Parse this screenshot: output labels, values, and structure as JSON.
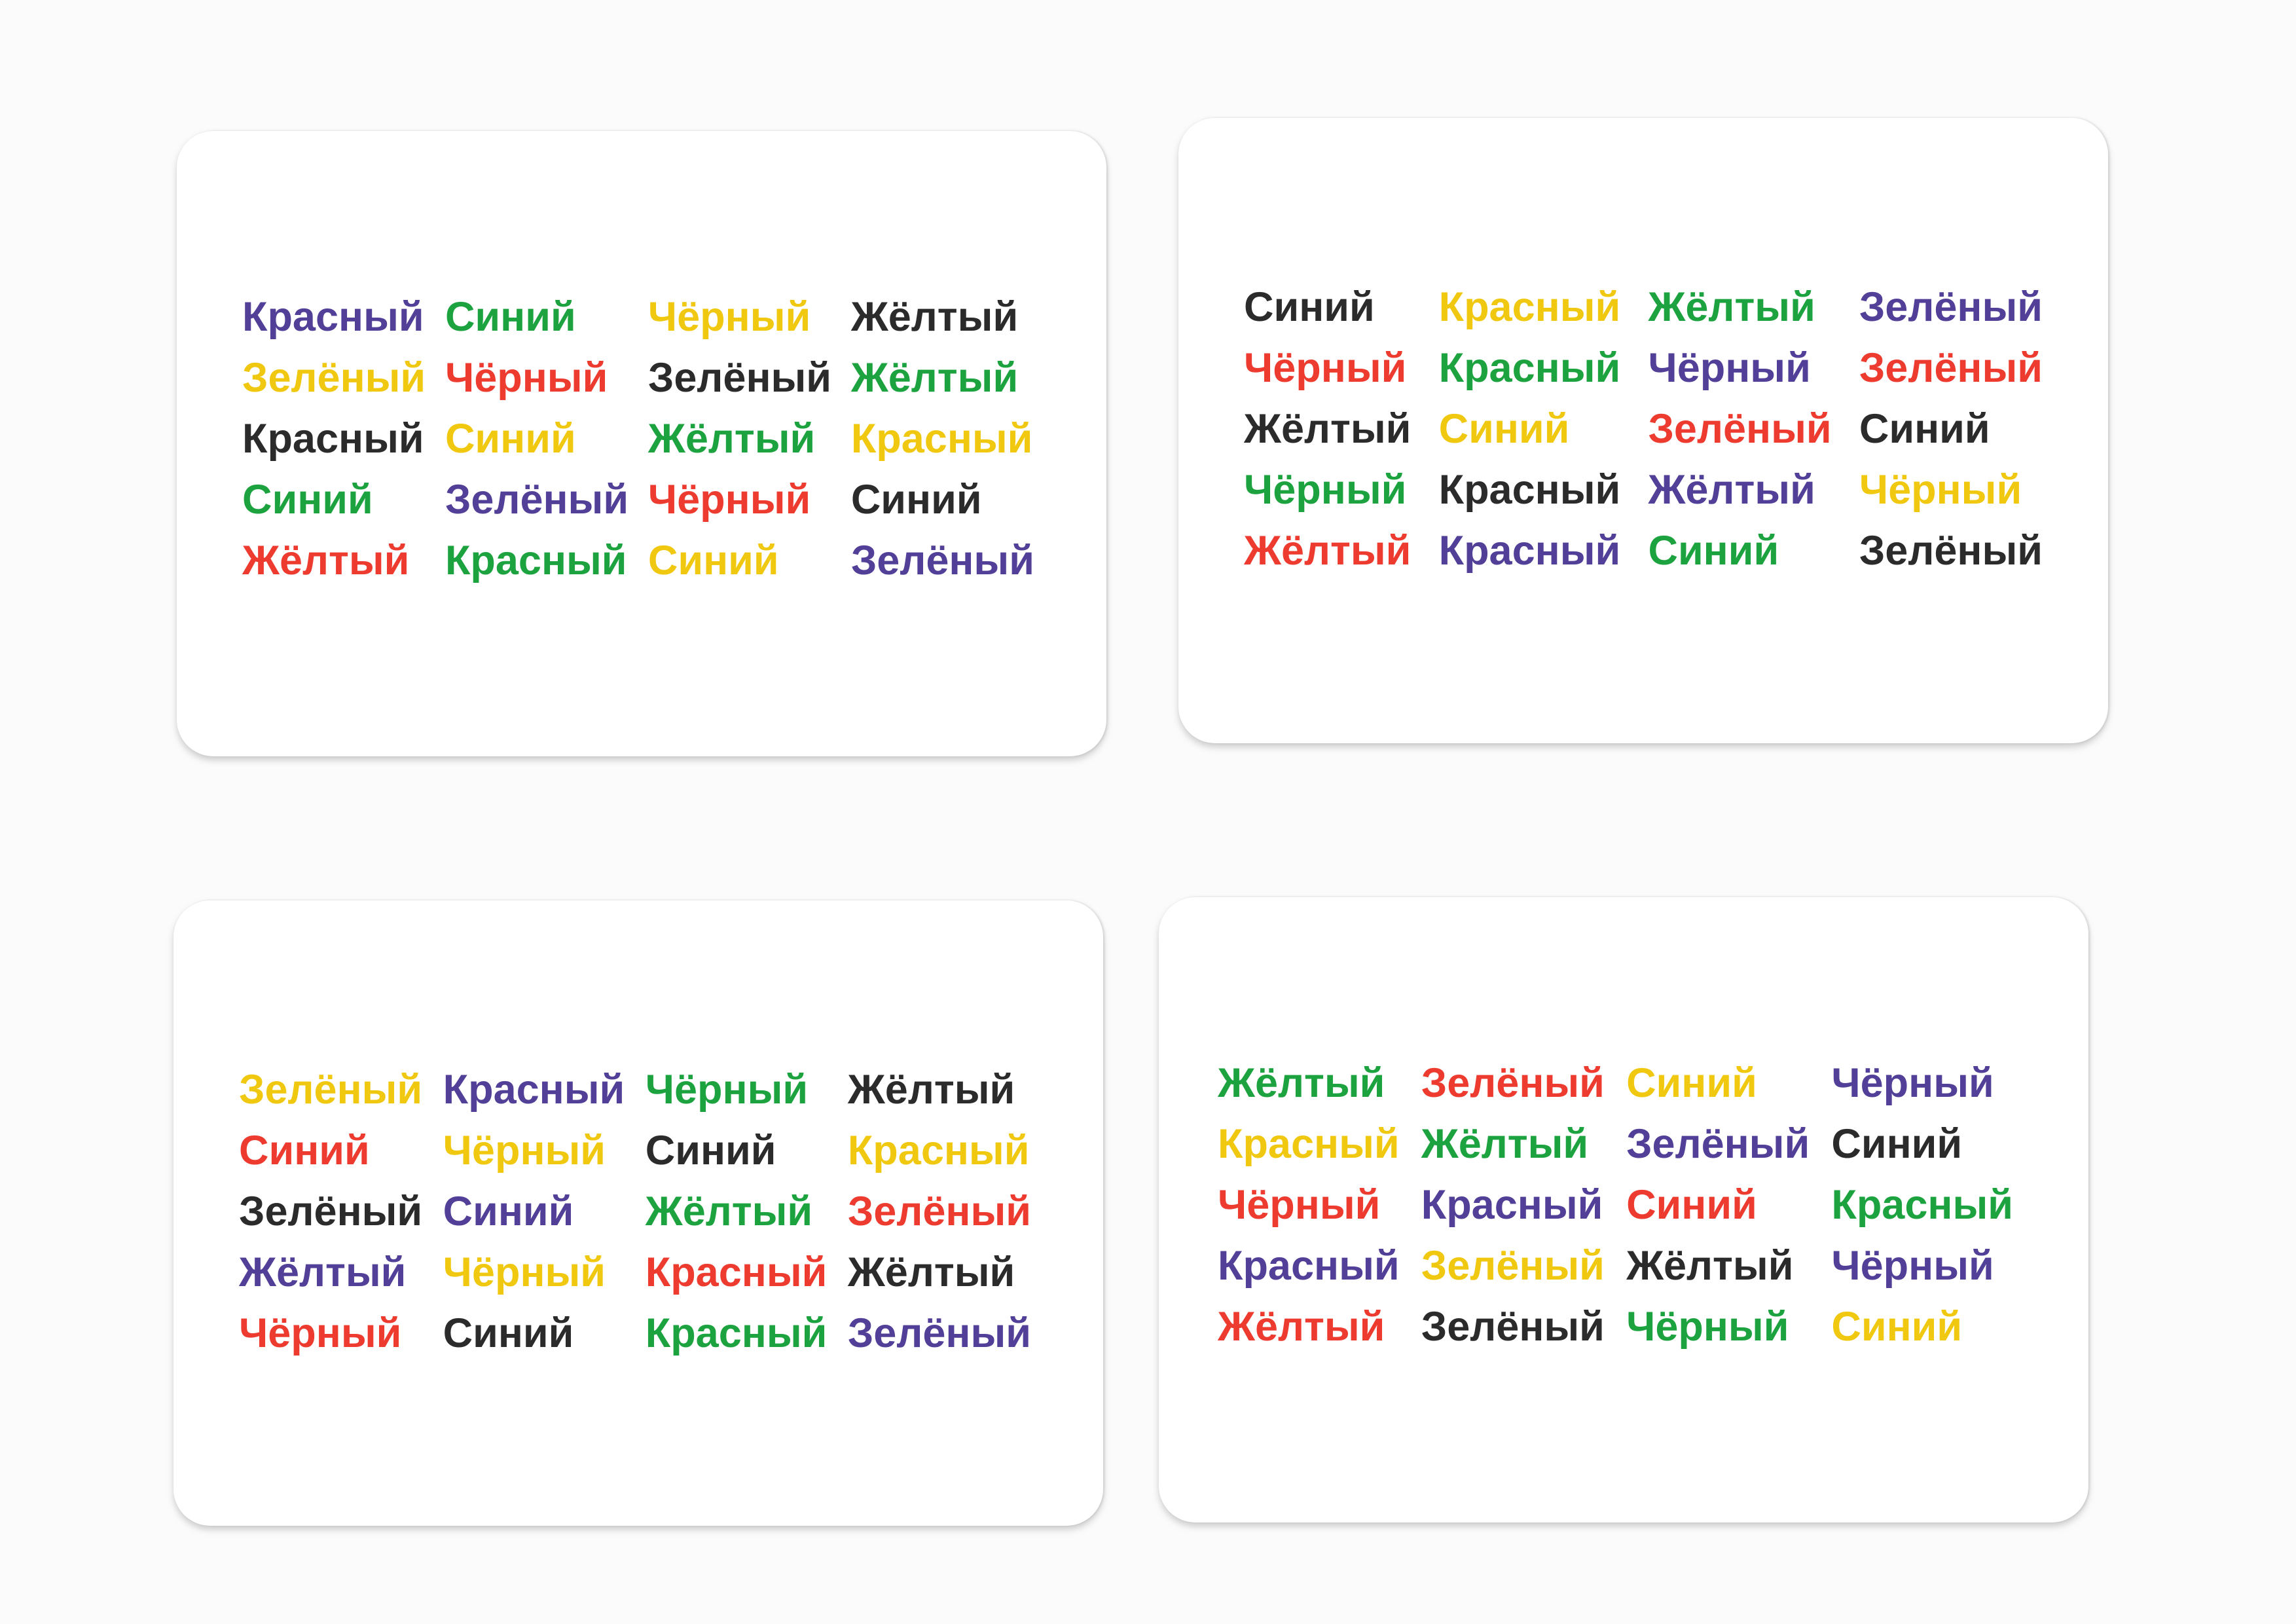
{
  "colors": {
    "red": "#ee3b30",
    "green": "#1ca33f",
    "yellow": "#f0c80f",
    "blue": "#523f97",
    "black": "#2b2b2b"
  },
  "cards": [
    {
      "words": [
        {
          "text": "Красный",
          "color": "blue"
        },
        {
          "text": "Синий",
          "color": "green"
        },
        {
          "text": "Чёрный",
          "color": "yellow"
        },
        {
          "text": "Жёлтый",
          "color": "black"
        },
        {
          "text": "Зелёный",
          "color": "yellow"
        },
        {
          "text": "Чёрный",
          "color": "red"
        },
        {
          "text": "Зелёный",
          "color": "black"
        },
        {
          "text": "Жёлтый",
          "color": "green"
        },
        {
          "text": "Красный",
          "color": "black"
        },
        {
          "text": "Синий",
          "color": "yellow"
        },
        {
          "text": "Жёлтый",
          "color": "green"
        },
        {
          "text": "Красный",
          "color": "yellow"
        },
        {
          "text": "Синий",
          "color": "green"
        },
        {
          "text": "Зелёный",
          "color": "blue"
        },
        {
          "text": "Чёрный",
          "color": "red"
        },
        {
          "text": "Синий",
          "color": "black"
        },
        {
          "text": "Жёлтый",
          "color": "red"
        },
        {
          "text": "Красный",
          "color": "green"
        },
        {
          "text": "Синий",
          "color": "yellow"
        },
        {
          "text": "Зелёный",
          "color": "blue"
        }
      ]
    },
    {
      "words": [
        {
          "text": "Синий",
          "color": "black"
        },
        {
          "text": "Красный",
          "color": "yellow"
        },
        {
          "text": "Жёлтый",
          "color": "green"
        },
        {
          "text": "Зелёный",
          "color": "blue"
        },
        {
          "text": "Чёрный",
          "color": "red"
        },
        {
          "text": "Красный",
          "color": "green"
        },
        {
          "text": "Чёрный",
          "color": "blue"
        },
        {
          "text": "Зелёный",
          "color": "red"
        },
        {
          "text": "Жёлтый",
          "color": "black"
        },
        {
          "text": "Синий",
          "color": "yellow"
        },
        {
          "text": "Зелёный",
          "color": "red"
        },
        {
          "text": "Синий",
          "color": "black"
        },
        {
          "text": "Чёрный",
          "color": "green"
        },
        {
          "text": "Красный",
          "color": "black"
        },
        {
          "text": "Жёлтый",
          "color": "blue"
        },
        {
          "text": "Чёрный",
          "color": "yellow"
        },
        {
          "text": "Жёлтый",
          "color": "red"
        },
        {
          "text": "Красный",
          "color": "blue"
        },
        {
          "text": "Синий",
          "color": "green"
        },
        {
          "text": "Зелёный",
          "color": "black"
        }
      ]
    },
    {
      "words": [
        {
          "text": "Зелёный",
          "color": "yellow"
        },
        {
          "text": "Красный",
          "color": "blue"
        },
        {
          "text": "Чёрный",
          "color": "green"
        },
        {
          "text": "Жёлтый",
          "color": "black"
        },
        {
          "text": "Синий",
          "color": "red"
        },
        {
          "text": "Чёрный",
          "color": "yellow"
        },
        {
          "text": "Синий",
          "color": "black"
        },
        {
          "text": "Красный",
          "color": "yellow"
        },
        {
          "text": "Зелёный",
          "color": "black"
        },
        {
          "text": "Синий",
          "color": "blue"
        },
        {
          "text": "Жёлтый",
          "color": "green"
        },
        {
          "text": "Зелёный",
          "color": "red"
        },
        {
          "text": "Жёлтый",
          "color": "blue"
        },
        {
          "text": "Чёрный",
          "color": "yellow"
        },
        {
          "text": "Красный",
          "color": "red"
        },
        {
          "text": "Жёлтый",
          "color": "black"
        },
        {
          "text": "Чёрный",
          "color": "red"
        },
        {
          "text": "Синий",
          "color": "black"
        },
        {
          "text": "Красный",
          "color": "green"
        },
        {
          "text": "Зелёный",
          "color": "blue"
        }
      ]
    },
    {
      "words": [
        {
          "text": "Жёлтый",
          "color": "green"
        },
        {
          "text": "Зелёный",
          "color": "red"
        },
        {
          "text": "Синий",
          "color": "yellow"
        },
        {
          "text": "Чёрный",
          "color": "blue"
        },
        {
          "text": "Красный",
          "color": "yellow"
        },
        {
          "text": "Жёлтый",
          "color": "green"
        },
        {
          "text": "Зелёный",
          "color": "blue"
        },
        {
          "text": "Синий",
          "color": "black"
        },
        {
          "text": "Чёрный",
          "color": "red"
        },
        {
          "text": "Красный",
          "color": "blue"
        },
        {
          "text": "Синий",
          "color": "red"
        },
        {
          "text": "Красный",
          "color": "green"
        },
        {
          "text": "Красный",
          "color": "blue"
        },
        {
          "text": "Зелёный",
          "color": "yellow"
        },
        {
          "text": "Жёлтый",
          "color": "black"
        },
        {
          "text": "Чёрный",
          "color": "blue"
        },
        {
          "text": "Жёлтый",
          "color": "red"
        },
        {
          "text": "Зелёный",
          "color": "black"
        },
        {
          "text": "Чёрный",
          "color": "green"
        },
        {
          "text": "Синий",
          "color": "yellow"
        }
      ]
    }
  ]
}
